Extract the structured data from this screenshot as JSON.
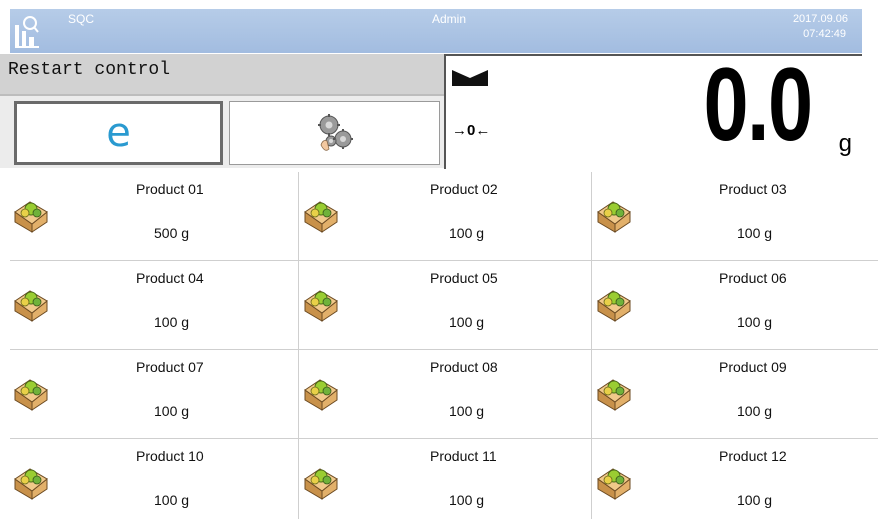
{
  "header": {
    "app_name": "SQC",
    "user": "Admin",
    "date": "2017.09.06",
    "time": "07:42:49"
  },
  "control": {
    "title": "Restart control",
    "buttons": [
      {
        "name": "e-button",
        "glyph": "e"
      },
      {
        "name": "settings-button",
        "icon": "gears-hand-icon"
      }
    ]
  },
  "weighing": {
    "value": "0.0",
    "unit": "g",
    "zero_indicator": "→0←",
    "stability_icon": "stability-marker-icon"
  },
  "products": [
    {
      "name": "Product 01",
      "mass": "500 g"
    },
    {
      "name": "Product 02",
      "mass": "100 g"
    },
    {
      "name": "Product 03",
      "mass": "100 g"
    },
    {
      "name": "Product 04",
      "mass": "100 g"
    },
    {
      "name": "Product 05",
      "mass": "100 g"
    },
    {
      "name": "Product 06",
      "mass": "100 g"
    },
    {
      "name": "Product 07",
      "mass": "100 g"
    },
    {
      "name": "Product 08",
      "mass": "100 g"
    },
    {
      "name": "Product 09",
      "mass": "100 g"
    },
    {
      "name": "Product 10",
      "mass": "100 g"
    },
    {
      "name": "Product 11",
      "mass": "100 g"
    },
    {
      "name": "Product 12",
      "mass": "100 g"
    }
  ],
  "colors": {
    "header_bg": "#a8c2e4",
    "accent_blue": "#2a9ad0",
    "box_tan": "#d9a45c",
    "ball_green": "#9acd32"
  }
}
